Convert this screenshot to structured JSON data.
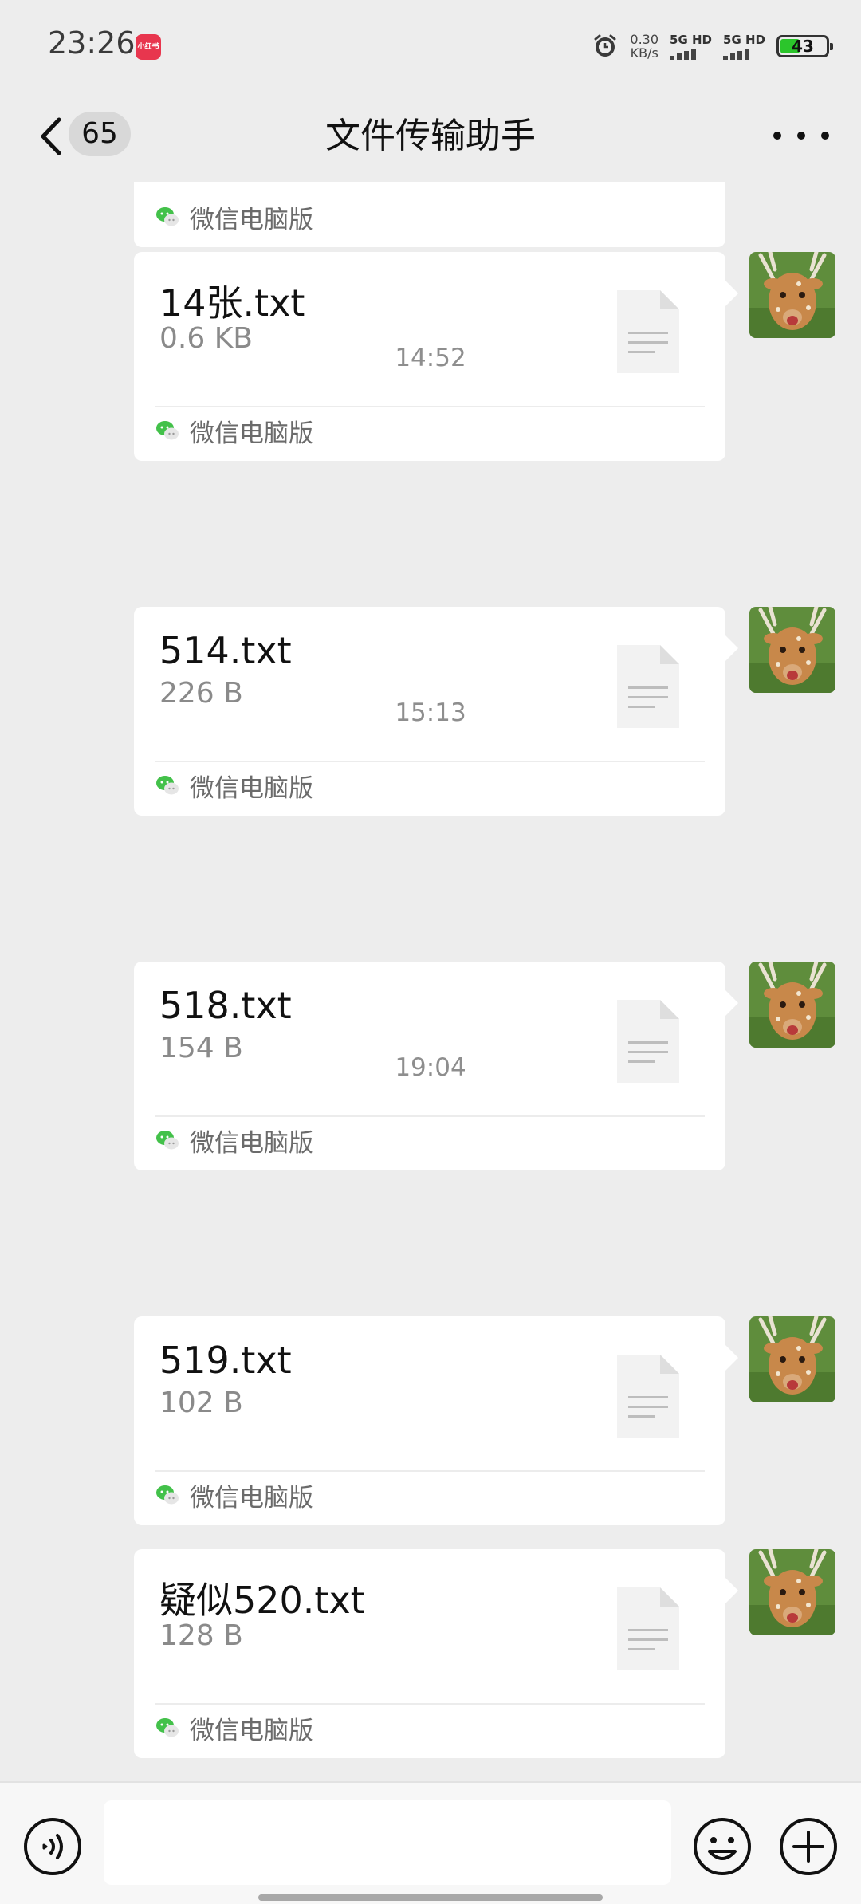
{
  "status_bar": {
    "time": "23:26",
    "app_badge": "小红书",
    "speed_value": "0.30",
    "speed_unit": "KB/s",
    "sim1": "5G HD",
    "sim2": "5G HD",
    "battery": "43"
  },
  "header": {
    "unread_count": "65",
    "title": "文件传输助手"
  },
  "messages": [
    {
      "name": "",
      "size": "",
      "source": "微信电脑版"
    },
    {
      "name": "14张.txt",
      "size": "0.6 KB",
      "source": "微信电脑版"
    },
    {
      "name": "514.txt",
      "size": "226 B",
      "source": "微信电脑版"
    },
    {
      "name": "518.txt",
      "size": "154 B",
      "source": "微信电脑版"
    },
    {
      "name": "519.txt",
      "size": "102 B",
      "source": "微信电脑版"
    },
    {
      "name": "疑似520.txt",
      "size": "128 B",
      "source": "微信电脑版"
    }
  ],
  "timestamps": [
    "14:52",
    "15:13",
    "19:04"
  ],
  "colors": {
    "background": "#ededed",
    "bubble": "#ffffff",
    "wechat_green": "#43c14a"
  },
  "icons": {
    "back": "chevron-left-icon",
    "more": "more-dots-icon",
    "file": "file-doc-icon",
    "source": "wechat-icon",
    "voice": "voice-icon",
    "emoji": "emoji-icon",
    "plus": "plus-icon"
  }
}
